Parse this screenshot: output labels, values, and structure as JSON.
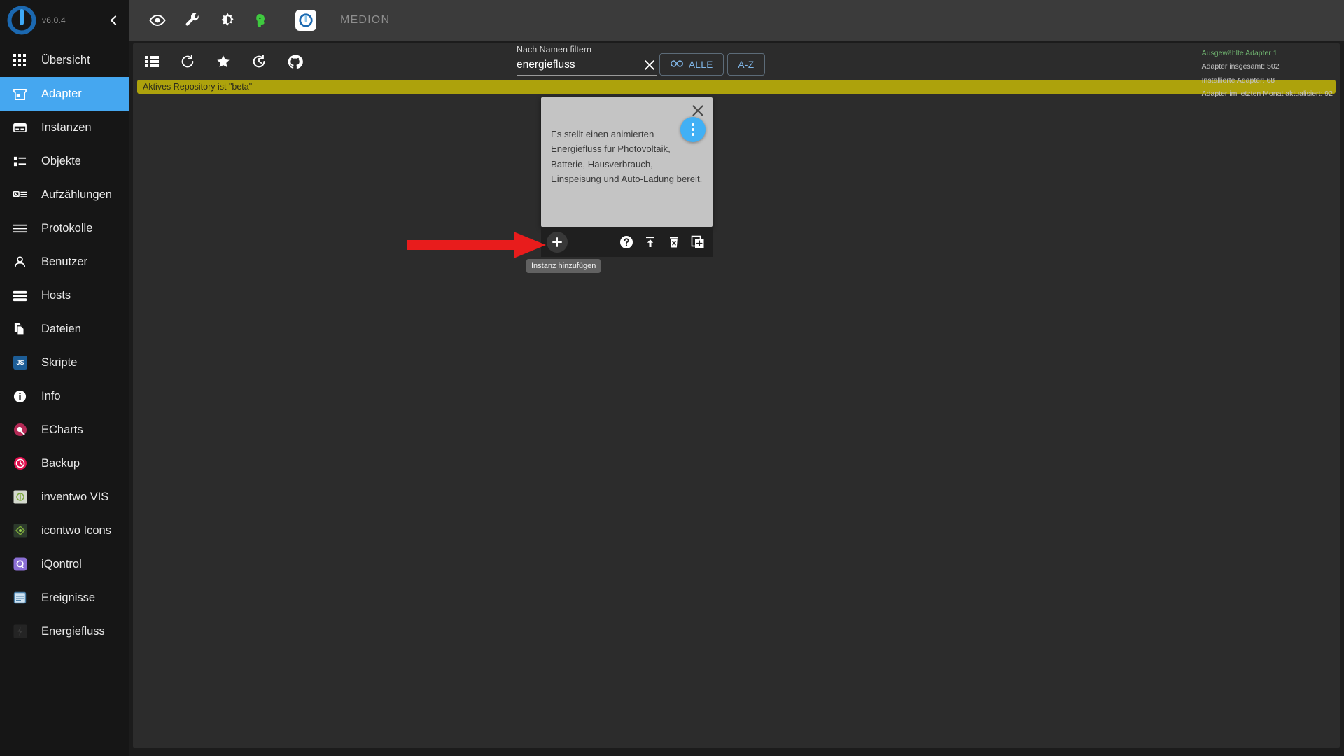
{
  "app": {
    "version": "v6.0.4",
    "brand_name": "MEDION",
    "logo_icon": "iobroker-logo-icon",
    "collapse_icon": "chevron-left-icon"
  },
  "sidebar": {
    "items": [
      {
        "label": "Übersicht",
        "icon": "grid-icon",
        "active": false,
        "kind": "glyph"
      },
      {
        "label": "Adapter",
        "icon": "store-icon",
        "active": true,
        "kind": "glyph"
      },
      {
        "label": "Instanzen",
        "icon": "instances-icon",
        "active": false,
        "kind": "glyph"
      },
      {
        "label": "Objekte",
        "icon": "list-objects-icon",
        "active": false,
        "kind": "glyph"
      },
      {
        "label": "Aufzählungen",
        "icon": "enums-icon",
        "active": false,
        "kind": "glyph"
      },
      {
        "label": "Protokolle",
        "icon": "logs-icon",
        "active": false,
        "kind": "glyph"
      },
      {
        "label": "Benutzer",
        "icon": "user-icon",
        "active": false,
        "kind": "glyph"
      },
      {
        "label": "Hosts",
        "icon": "hosts-icon",
        "active": false,
        "kind": "glyph"
      },
      {
        "label": "Dateien",
        "icon": "files-icon",
        "active": false,
        "kind": "glyph"
      },
      {
        "label": "Skripte",
        "icon": "javascript-icon",
        "active": false,
        "kind": "tile",
        "color": "#1d5d96"
      },
      {
        "label": "Info",
        "icon": "info-icon",
        "active": false,
        "kind": "glyph"
      },
      {
        "label": "ECharts",
        "icon": "echarts-icon",
        "active": false,
        "kind": "tile",
        "color": "#b42a56"
      },
      {
        "label": "Backup",
        "icon": "backup-clock-icon",
        "active": false,
        "kind": "tile",
        "color": "#e11250"
      },
      {
        "label": "inventwo VIS",
        "icon": "inventwo-vis-icon",
        "active": false,
        "kind": "tile",
        "color": "#d4d9ce"
      },
      {
        "label": "icontwo Icons",
        "icon": "icontwo-icons-icon",
        "active": false,
        "kind": "tile",
        "color": "#2c3a2c"
      },
      {
        "label": "iQontrol",
        "icon": "iqontrol-icon",
        "active": false,
        "kind": "tile",
        "color": "#8b6fd4"
      },
      {
        "label": "Ereignisse",
        "icon": "events-icon",
        "active": false,
        "kind": "tile",
        "color": "#cfe3f2"
      },
      {
        "label": "Energiefluss",
        "icon": "energiefluss-icon",
        "active": false,
        "kind": "tile",
        "color": "#2a2a2a"
      }
    ]
  },
  "topbar": {
    "icons": [
      {
        "name": "eye-icon",
        "title": "Expert mode"
      },
      {
        "name": "wrench-icon",
        "title": "Settings"
      },
      {
        "name": "contrast-icon",
        "title": "Theme"
      },
      {
        "name": "green-head-icon",
        "title": "Host"
      }
    ]
  },
  "toolbar": {
    "icons": [
      {
        "name": "list-view-icon",
        "title": "List view"
      },
      {
        "name": "refresh-icon",
        "title": "Refresh"
      },
      {
        "name": "star-icon",
        "title": "Favorites"
      },
      {
        "name": "update-history-icon",
        "title": "Updates"
      },
      {
        "name": "github-icon",
        "title": "GitHub"
      }
    ],
    "filter_all_label": "ALLE",
    "filter_all_icon": "infinity-icon",
    "sort_az_label": "A-Z"
  },
  "search": {
    "label": "Nach Namen filtern",
    "value": "energiefluss",
    "placeholder": "",
    "clear_icon": "close-x-icon"
  },
  "stats": {
    "selected": "Ausgewählte Adapter 1",
    "total": "Adapter insgesamt: 502",
    "installed": "Installierte Adapter: 68",
    "updated": "Adapter im letzten Monat aktualisiert: 92",
    "highlight_color": "#6fb36f"
  },
  "banner": {
    "text": "Aktives Repository ist \"beta\"",
    "color": "#ada20c"
  },
  "card": {
    "description": "Es stellt einen animierten Energiefluss für Photovoltaik, Batterie, Hausverbrauch, Einspeisung und Auto-Ladung bereit.",
    "close_icon": "close-x-icon",
    "menu_icon": "more-vert-icon",
    "menu_color": "#41b0f5",
    "add_instance_icon": "plus-icon",
    "actions": [
      {
        "name": "help-icon",
        "title": "Hilfe"
      },
      {
        "name": "upload-update-icon",
        "title": "Aktualisieren"
      },
      {
        "name": "delete-icon",
        "title": "Löschen"
      },
      {
        "name": "add-copy-icon",
        "title": "Hinzufügen"
      }
    ],
    "tooltip": "Instanz hinzufügen"
  },
  "annotation": {
    "arrow_color": "#e81c1c",
    "arrow_name": "red-pointer-arrow"
  }
}
